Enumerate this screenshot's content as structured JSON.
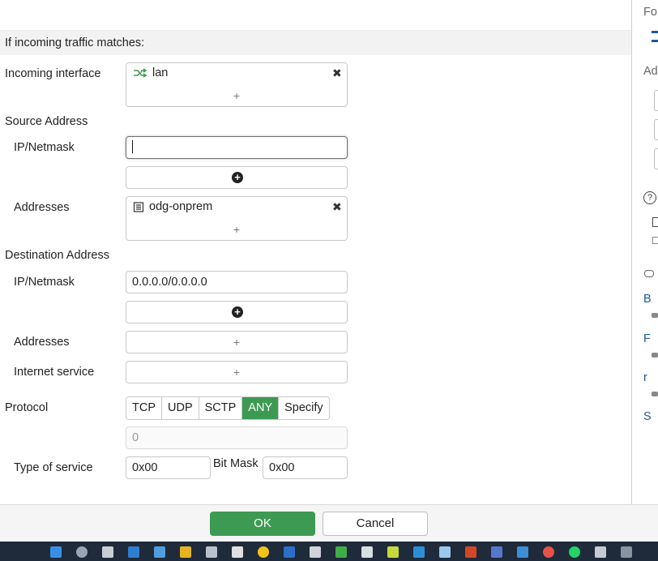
{
  "section_header": "If incoming traffic matches:",
  "incoming_interface": {
    "label": "Incoming interface",
    "value": "lan",
    "add": "+"
  },
  "source": {
    "heading": "Source Address",
    "ipnetmask_label": "IP/Netmask",
    "ipnetmask_value": "",
    "addresses_label": "Addresses",
    "addresses_value": "odg-onprem",
    "add": "+"
  },
  "destination": {
    "heading": "Destination Address",
    "ipnetmask_label": "IP/Netmask",
    "ipnetmask_value": "0.0.0.0/0.0.0.0",
    "addresses_label": "Addresses",
    "internet_service_label": "Internet service",
    "add": "+"
  },
  "protocol": {
    "label": "Protocol",
    "options": [
      "TCP",
      "UDP",
      "SCTP",
      "ANY",
      "Specify"
    ],
    "selected": "ANY",
    "number_value": "0"
  },
  "tos": {
    "label": "Type of service",
    "value": "0x00",
    "bitmask_label": "Bit Mask",
    "bitmask_value": "0x00"
  },
  "buttons": {
    "ok": "OK",
    "cancel": "Cancel"
  },
  "side_panel": {
    "texts": [
      "Fo",
      "Ad",
      "B",
      "F",
      "r",
      "S"
    ]
  },
  "colors": {
    "accent_green": "#3d9a52",
    "link_blue": "#1c5a99"
  }
}
